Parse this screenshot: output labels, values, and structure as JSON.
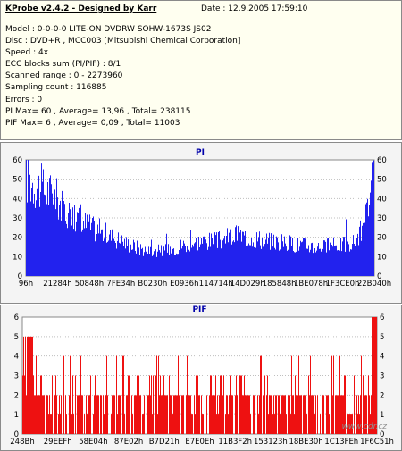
{
  "header": {
    "title": "KProbe v2.4.2 - Designed by Karr",
    "date": "Date : 12.9.2005 17:59:10",
    "lines": [
      "Model : 0-0-0-0 LITE-ON DVDRW SOHW-1673S JS02",
      "Disc : DVD+R , MCC003 [Mitsubishi Chemical Corporation]",
      "Speed : 4x",
      "ECC blocks sum (PI/PIF) : 8/1",
      "Scanned range : 0 - 2273960",
      "Sampling count : 116885",
      "Errors : 0",
      "PI Max= 60 , Average= 13,96 , Total= 238115",
      "PIF Max= 6 , Average= 0,09 , Total= 11003"
    ]
  },
  "watermark": "www.cdr.cz",
  "chart_data": [
    {
      "type": "bar",
      "title": "PI",
      "color": "#2222ee",
      "ylim": [
        0,
        60
      ],
      "yticks": [
        0,
        10,
        20,
        30,
        40,
        50,
        60
      ],
      "x_tick_labels": [
        "96h",
        "21284h",
        "50848h",
        "7FE34h",
        "B0230h",
        "E0936h",
        "114714h",
        "14D029h",
        "185848h",
        "1BE078h",
        "1F3CE0h",
        "22B040h"
      ],
      "profile": [
        [
          0,
          50
        ],
        [
          0.04,
          46
        ],
        [
          0.08,
          42
        ],
        [
          0.12,
          33
        ],
        [
          0.16,
          28
        ],
        [
          0.2,
          24
        ],
        [
          0.25,
          20
        ],
        [
          0.3,
          16
        ],
        [
          0.35,
          13
        ],
        [
          0.4,
          13
        ],
        [
          0.45,
          16
        ],
        [
          0.5,
          18
        ],
        [
          0.55,
          18
        ],
        [
          0.6,
          21
        ],
        [
          0.65,
          20
        ],
        [
          0.7,
          18
        ],
        [
          0.75,
          17
        ],
        [
          0.8,
          16
        ],
        [
          0.85,
          15
        ],
        [
          0.9,
          16
        ],
        [
          0.94,
          17
        ],
        [
          0.97,
          25
        ],
        [
          0.99,
          42
        ],
        [
          1.0,
          52
        ]
      ],
      "max": 60,
      "average": 13.96
    },
    {
      "type": "bar",
      "title": "PIF",
      "color": "#ee1111",
      "ylim": [
        0,
        6
      ],
      "yticks": [
        0,
        1,
        2,
        3,
        4,
        5,
        6
      ],
      "x_tick_labels": [
        "248Bh",
        "29EEFh",
        "58E04h",
        "87E02h",
        "B7D21h",
        "E7E0Eh",
        "11B3F2h",
        "153123h",
        "18BE30h",
        "1C13FEh",
        "1F6C51h"
      ],
      "base_level": 2,
      "max": 6,
      "average": 0.09
    }
  ]
}
